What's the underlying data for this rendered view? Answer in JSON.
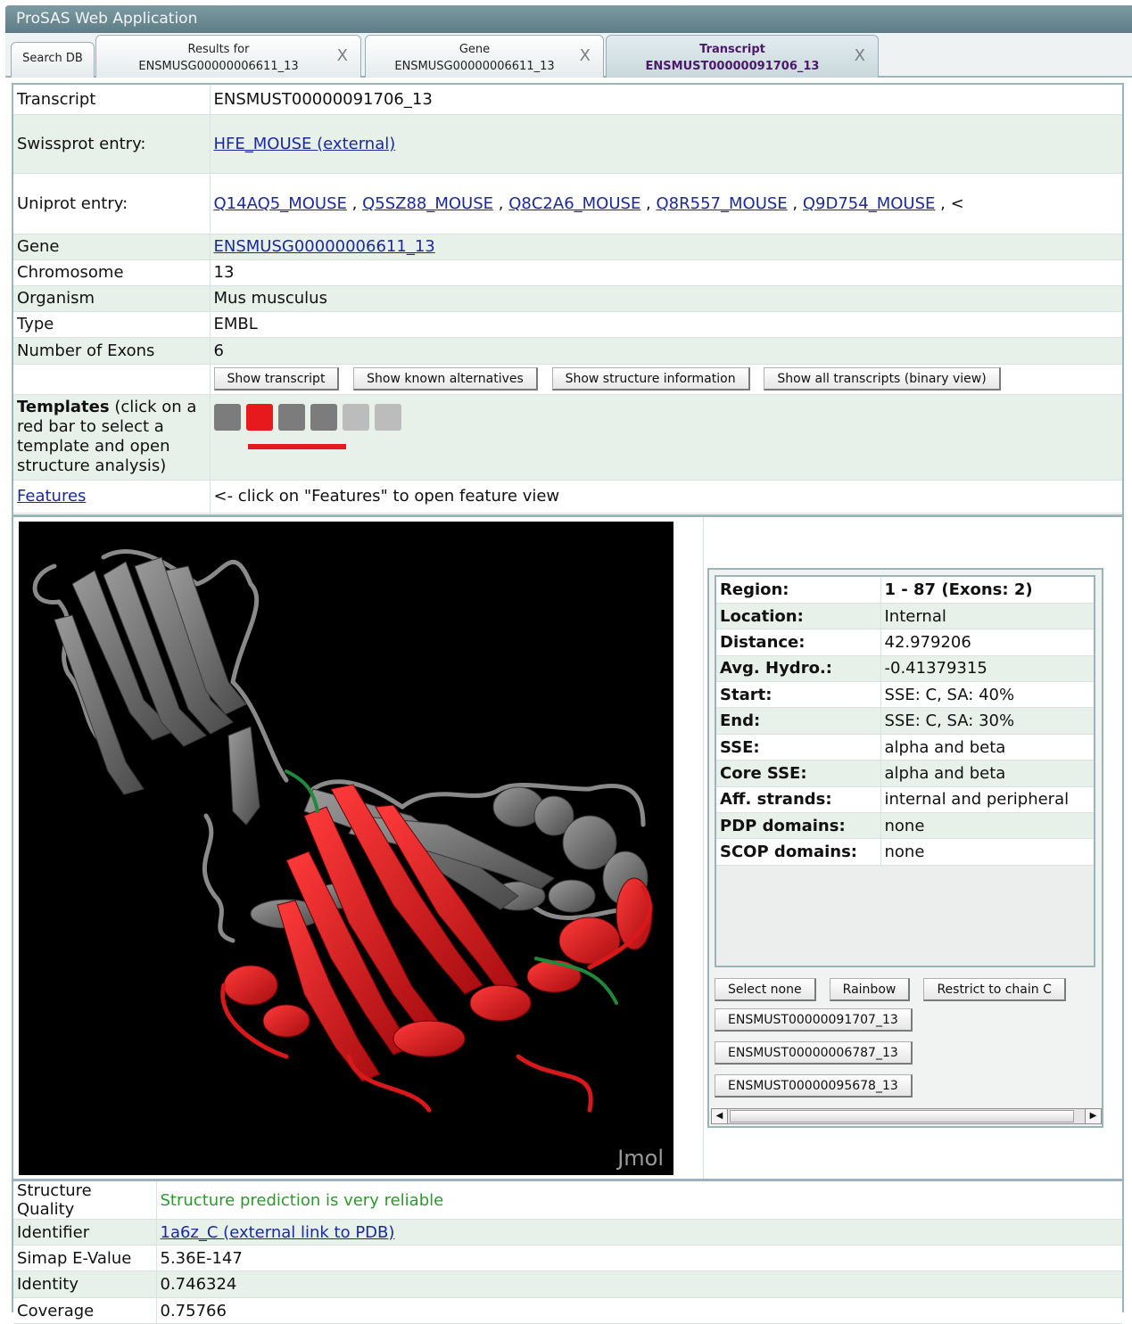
{
  "app": {
    "title": "ProSAS Web Application"
  },
  "tabs": [
    {
      "l1": "Search DB",
      "l2": "",
      "closable": false,
      "active": false
    },
    {
      "l1": "Results for",
      "l2": "ENSMUSG00000006611_13",
      "closable": true,
      "active": false
    },
    {
      "l1": "Gene",
      "l2": "ENSMUSG00000006611_13",
      "closable": true,
      "active": false
    },
    {
      "l1": "Transcript",
      "l2": "ENSMUST00000091706_13",
      "closable": true,
      "active": true
    }
  ],
  "close_glyph": "X",
  "info": {
    "transcript": {
      "label": "Transcript",
      "value": "ENSMUST00000091706_13"
    },
    "swissprot": {
      "label": "Swissprot entry:",
      "value": "HFE_MOUSE (external)"
    },
    "uniprot": {
      "label": "Uniprot entry:",
      "links": [
        "Q14AQ5_MOUSE",
        "Q5SZ88_MOUSE",
        "Q8C2A6_MOUSE",
        "Q8R557_MOUSE",
        "Q9D754_MOUSE"
      ],
      "separator": ",",
      "tail": "<"
    },
    "gene": {
      "label": "Gene",
      "value": "ENSMUSG00000006611_13"
    },
    "chromosome": {
      "label": "Chromosome",
      "value": "13"
    },
    "organism": {
      "label": "Organism",
      "value": "Mus musculus"
    },
    "type": {
      "label": "Type",
      "value": "EMBL"
    },
    "exons": {
      "label": "Number of Exons",
      "value": "6"
    }
  },
  "buttons": {
    "show_transcript": "Show transcript",
    "show_alternatives": "Show known alternatives",
    "show_structure": "Show structure information",
    "show_all": "Show all transcripts (binary view)"
  },
  "templates": {
    "label_bold": "Templates",
    "label_rest": " (click on a red bar to select a template and open structure analysis)",
    "colors": [
      "#7c7c7c",
      "#e8191c",
      "#7c7c7c",
      "#7c7c7c",
      "#bcbcbc",
      "#bcbcbc"
    ],
    "selected_index": 1
  },
  "features": {
    "label": "Features",
    "hint": "<- click on \"Features\" to open feature view"
  },
  "viewer": {
    "watermark": "Jmol",
    "highlight_color": "#e8191c",
    "base_color": "#7a7a7a",
    "loop_color": "#1f8a3a"
  },
  "region": [
    {
      "k": "Region:",
      "v": "1 - 87 (Exons: 2)",
      "bold": true
    },
    {
      "k": "Location:",
      "v": "Internal"
    },
    {
      "k": "Distance:",
      "v": "42.979206"
    },
    {
      "k": "Avg. Hydro.:",
      "v": "-0.41379315"
    },
    {
      "k": "Start:",
      "v": "SSE: C, SA: 40%"
    },
    {
      "k": "End:",
      "v": "SSE: C, SA: 30%"
    },
    {
      "k": "SSE:",
      "v": "alpha and beta"
    },
    {
      "k": "Core SSE:",
      "v": "alpha and beta"
    },
    {
      "k": "Aff. strands:",
      "v": "internal and peripheral"
    },
    {
      "k": "PDP domains:",
      "v": "none"
    },
    {
      "k": "SCOP domains:",
      "v": "none"
    }
  ],
  "region_buttons": {
    "select_none": "Select none",
    "rainbow": "Rainbow",
    "restrict": "Restrict to chain C"
  },
  "alt_transcripts": [
    "ENSMUST00000091707_13",
    "ENSMUST00000006787_13",
    "ENSMUST00000095678_13"
  ],
  "quality": {
    "structure_quality": {
      "label": "Structure Quality",
      "value": "Structure prediction is very reliable"
    },
    "identifier": {
      "label": "Identifier",
      "value": "1a6z_C (external link to PDB)"
    },
    "evalue": {
      "label": "Simap E-Value",
      "value": "5.36E-147"
    },
    "identity": {
      "label": "Identity",
      "value": "0.746324"
    },
    "coverage": {
      "label": "Coverage",
      "value": "0.75766"
    }
  }
}
